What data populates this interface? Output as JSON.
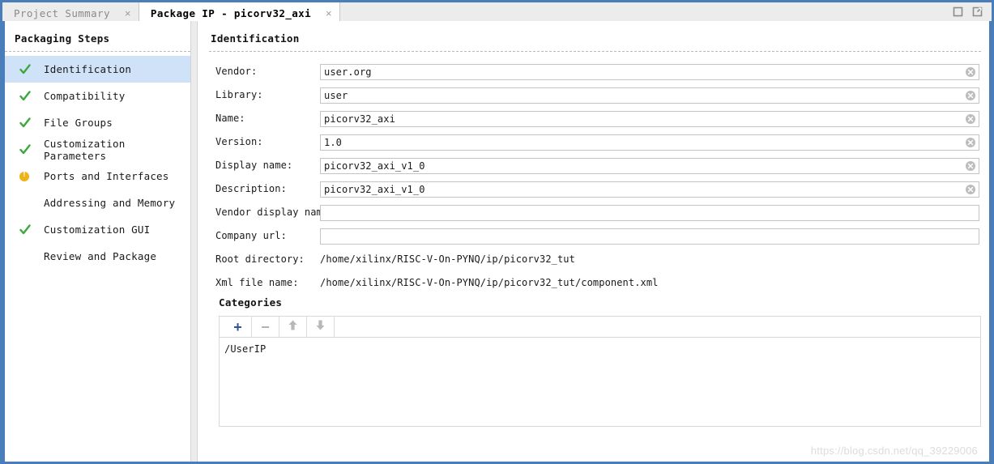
{
  "window": {
    "controls": [
      {
        "name": "maximize-button",
        "icon": "maximize-icon"
      },
      {
        "name": "float-button",
        "icon": "float-window-icon"
      }
    ]
  },
  "tabs": [
    {
      "label": "Project Summary",
      "active": false,
      "close": "×"
    },
    {
      "label": "Package IP - picorv32_axi",
      "active": true,
      "close": "×"
    }
  ],
  "sidebar": {
    "title": "Packaging Steps",
    "items": [
      {
        "label": "Identification",
        "status": "done",
        "selected": true
      },
      {
        "label": "Compatibility",
        "status": "done",
        "selected": false
      },
      {
        "label": "File Groups",
        "status": "done",
        "selected": false
      },
      {
        "label": "Customization Parameters",
        "status": "done",
        "selected": false
      },
      {
        "label": "Ports and Interfaces",
        "status": "warning",
        "selected": false
      },
      {
        "label": "Addressing and Memory",
        "status": "none",
        "selected": false
      },
      {
        "label": "Customization GUI",
        "status": "done",
        "selected": false
      },
      {
        "label": "Review and Package",
        "status": "none",
        "selected": false
      }
    ]
  },
  "main": {
    "title": "Identification",
    "fields": [
      {
        "label": "Vendor:",
        "value": "user.org",
        "type": "input",
        "clearable": true
      },
      {
        "label": "Library:",
        "value": "user",
        "type": "input",
        "clearable": true
      },
      {
        "label": "Name:",
        "value": "picorv32_axi",
        "type": "input",
        "clearable": true
      },
      {
        "label": "Version:",
        "value": "1.0",
        "type": "input",
        "clearable": true
      },
      {
        "label": "Display name:",
        "value": "picorv32_axi_v1_0",
        "type": "input",
        "clearable": true
      },
      {
        "label": "Description:",
        "value": "picorv32_axi_v1_0",
        "type": "input",
        "clearable": true
      },
      {
        "label": "Vendor display name:",
        "value": "",
        "type": "input",
        "clearable": false
      },
      {
        "label": "Company url:",
        "value": "",
        "type": "input",
        "clearable": false
      },
      {
        "label": "Root directory:",
        "value": "/home/xilinx/RISC-V-On-PYNQ/ip/picorv32_tut",
        "type": "text",
        "clearable": false
      },
      {
        "label": "Xml file name:",
        "value": "/home/xilinx/RISC-V-On-PYNQ/ip/picorv32_tut/component.xml",
        "type": "text",
        "clearable": false
      }
    ]
  },
  "categories": {
    "title": "Categories",
    "toolbar": [
      {
        "name": "add-category-button",
        "icon": "plus-icon",
        "label": "+",
        "enabled": true
      },
      {
        "name": "remove-category-button",
        "icon": "minus-icon",
        "label": "−",
        "enabled": false
      },
      {
        "name": "move-up-category-button",
        "icon": "arrow-up-icon",
        "label": "",
        "enabled": false
      },
      {
        "name": "move-down-category-button",
        "icon": "arrow-down-icon",
        "label": "",
        "enabled": false
      }
    ],
    "items": [
      "/UserIP"
    ]
  },
  "watermark": "https://blog.csdn.net/qq_39229006",
  "colors": {
    "window_border": "#4a7ebb",
    "selection": "#cfe2f7",
    "check_green": "#3aa83a",
    "warning_amber": "#f0b21b",
    "plus_blue": "#2f5597",
    "tab_inactive_bg": "#ececec"
  }
}
